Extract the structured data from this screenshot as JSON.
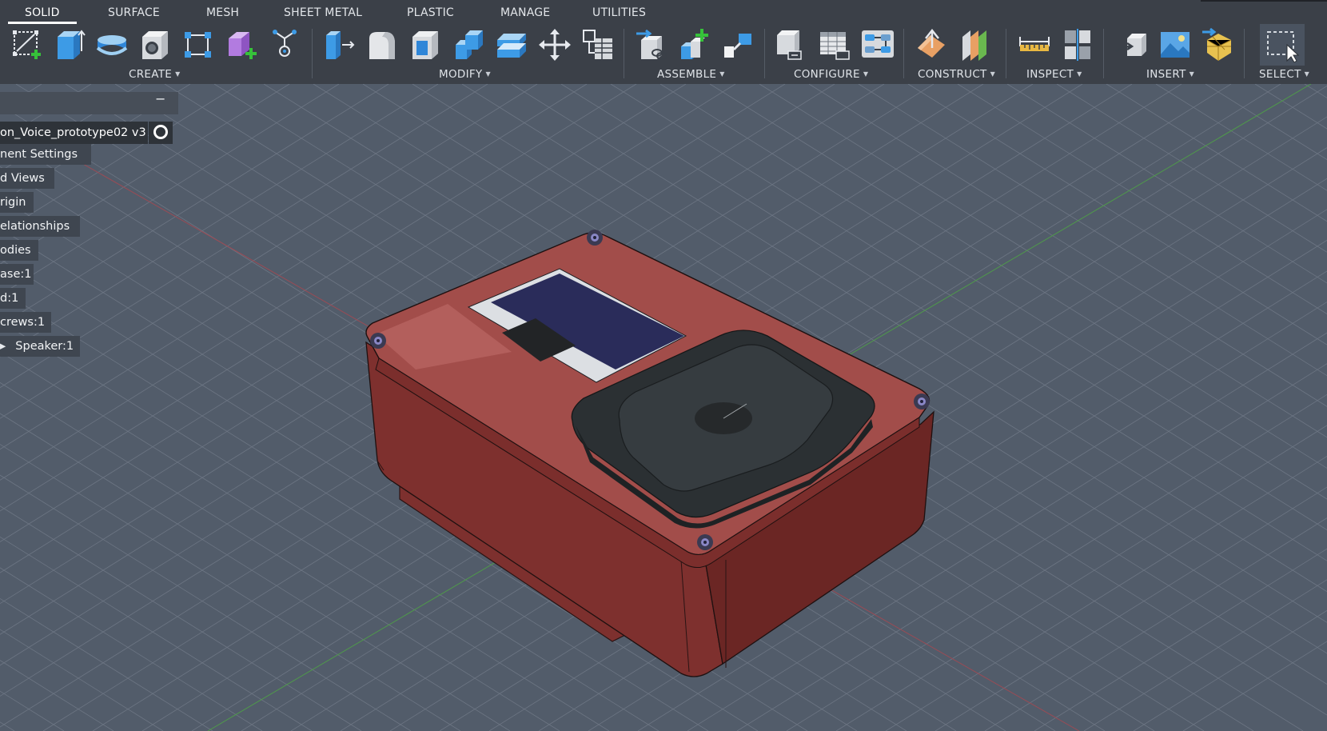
{
  "tabs": [
    "SOLID",
    "SURFACE",
    "MESH",
    "SHEET METAL",
    "PLASTIC",
    "MANAGE",
    "UTILITIES"
  ],
  "groups": {
    "create": "CREATE",
    "modify": "MODIFY",
    "assemble": "ASSEMBLE",
    "configure": "CONFIGURE",
    "construct": "CONSTRUCT",
    "inspect": "INSPECT",
    "insert": "INSERT",
    "select": "SELECT"
  },
  "browser": {
    "document": "on_Voice_prototype02 v3",
    "items": [
      "nent Settings",
      "d Views",
      "rigin",
      "elationships",
      "odies",
      "ase:1",
      "d:1",
      "crews:1",
      "Speaker:1"
    ]
  },
  "colors": {
    "toolbar": "#3b4048",
    "viewport": "#525c6a",
    "model_body": "#8e3c3a",
    "model_top": "#a8514e",
    "display": "#2a2c5a",
    "speaker": "#343a3e"
  },
  "icons": {
    "create": [
      "new-sketch-icon",
      "extrude-icon",
      "revolve-icon",
      "hole-icon",
      "pattern-icon",
      "new-component-icon",
      "create-form-icon"
    ],
    "modify": [
      "press-pull-icon",
      "fillet-icon",
      "shell-icon",
      "combine-icon",
      "offset-face-icon",
      "move-icon",
      "parameters-icon"
    ],
    "assemble": [
      "joint-icon",
      "new-component-assemble-icon",
      "as-built-joint-icon"
    ],
    "configure": [
      "configure-icon",
      "configuration-table-icon",
      "theme-table-icon"
    ],
    "construct": [
      "offset-plane-icon",
      "midplane-icon"
    ],
    "inspect": [
      "measure-icon",
      "section-analysis-icon"
    ],
    "insert": [
      "insert-derive-icon",
      "decal-icon",
      "insert-mesh-icon"
    ],
    "select": [
      "select-window-icon"
    ]
  }
}
